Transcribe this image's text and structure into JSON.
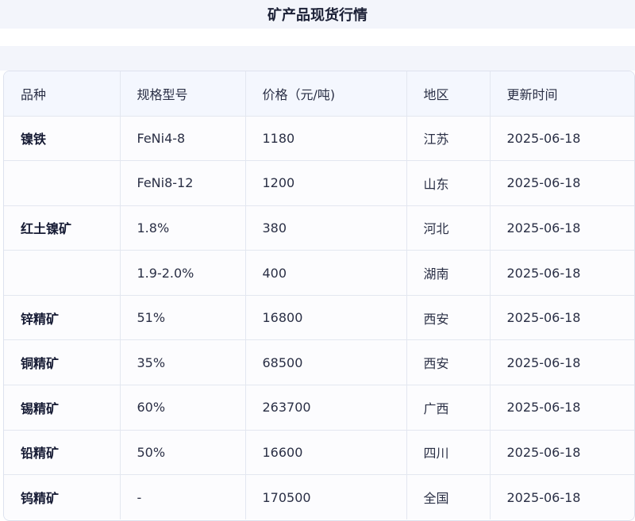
{
  "title": "矿产品现货行情",
  "table": {
    "headers": [
      "品种",
      "规格型号",
      "价格（元/吨)",
      "地区",
      "更新时间"
    ],
    "rows": [
      {
        "product": "镍铁",
        "spec": "FeNi4-8",
        "price": "1180",
        "region": "江苏",
        "date": "2025-06-18"
      },
      {
        "product": "",
        "spec": "FeNi8-12",
        "price": "1200",
        "region": "山东",
        "date": "2025-06-18"
      },
      {
        "product": "红土镍矿",
        "spec": "1.8%",
        "price": "380",
        "region": "河北",
        "date": "2025-06-18"
      },
      {
        "product": "",
        "spec": "1.9-2.0%",
        "price": "400",
        "region": "湖南",
        "date": "2025-06-18"
      },
      {
        "product": "锌精矿",
        "spec": "51%",
        "price": "16800",
        "region": "西安",
        "date": "2025-06-18"
      },
      {
        "product": "铜精矿",
        "spec": "35%",
        "price": "68500",
        "region": "西安",
        "date": "2025-06-18"
      },
      {
        "product": "锡精矿",
        "spec": "60%",
        "price": "263700",
        "region": "广西",
        "date": "2025-06-18"
      },
      {
        "product": "铅精矿",
        "spec": "50%",
        "price": "16600",
        "region": "四川",
        "date": "2025-06-18"
      },
      {
        "product": "钨精矿",
        "spec": "-",
        "price": "170500",
        "region": "全国",
        "date": "2025-06-18"
      }
    ]
  }
}
